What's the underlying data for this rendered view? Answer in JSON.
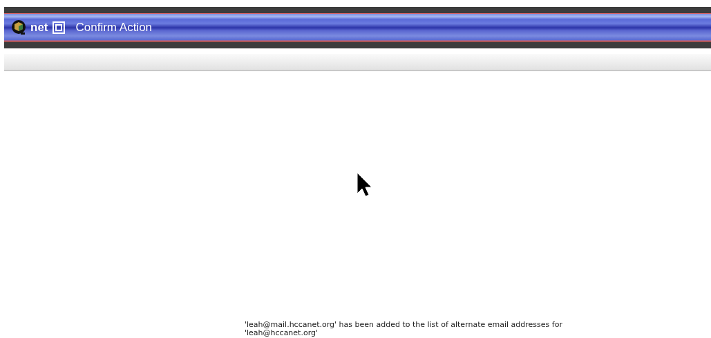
{
  "header": {
    "logo_text": "net",
    "title": "Confirm Action"
  },
  "message": "'leah@mail.hccanet.org' has been added to the list of alternate email addresses for 'leah@hccanet.org'"
}
